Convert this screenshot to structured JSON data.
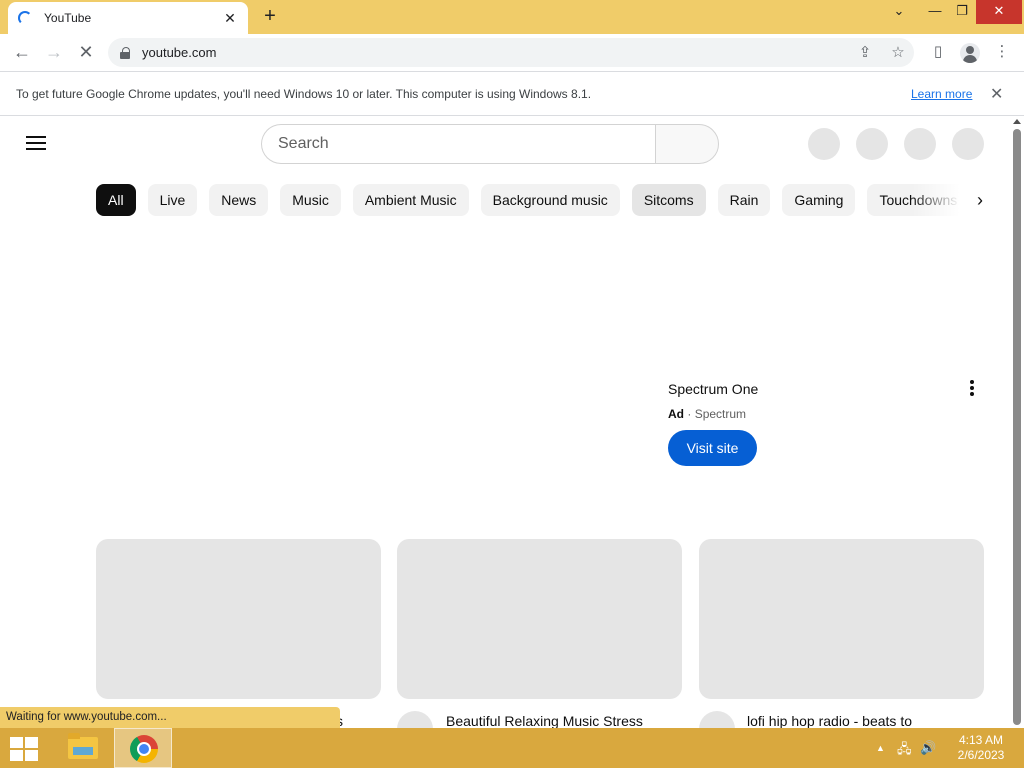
{
  "browser": {
    "tab": {
      "title": "YouTube",
      "close": "✕"
    },
    "new_tab": "+",
    "window": {
      "tabsearch": "⌄",
      "minimize": "—",
      "restore": "❐",
      "close": "✕"
    },
    "nav": {
      "back": "←",
      "forward": "→",
      "stop": "✕"
    },
    "address": {
      "url": "youtube.com"
    },
    "omnibox_icons": {
      "share": "⇪",
      "bookmark": "☆"
    },
    "toolbar_icons": {
      "side_panel": "▯",
      "menu": "⋮"
    },
    "status_text": "Waiting for www.youtube.com..."
  },
  "infobar": {
    "message": "To get future Google Chrome updates, you'll need Windows 10 or later. This computer is using Windows 8.1.",
    "link": "Learn more",
    "close": "✕"
  },
  "youtube": {
    "search": {
      "placeholder": "Search"
    },
    "chips": [
      {
        "label": "All"
      },
      {
        "label": "Live"
      },
      {
        "label": "News"
      },
      {
        "label": "Music"
      },
      {
        "label": "Ambient Music"
      },
      {
        "label": "Background music"
      },
      {
        "label": "Sitcoms"
      },
      {
        "label": "Rain"
      },
      {
        "label": "Gaming"
      },
      {
        "label": "Touchdowns"
      }
    ],
    "chip_next": "›",
    "ad": {
      "title": "Spectrum One",
      "badge": "Ad",
      "separator": "·",
      "advertiser": "Spectrum",
      "button": "Visit site"
    },
    "videos": [
      {
        "title": "s"
      },
      {
        "title": "Beautiful Relaxing Music Stress"
      },
      {
        "title": "lofi hip hop radio - beats to"
      }
    ]
  },
  "taskbar": {
    "tray": {
      "expand": "▲",
      "network": "🖧",
      "volume": "🔊"
    },
    "clock": {
      "time": "4:13 AM",
      "date": "2/6/2023"
    }
  }
}
